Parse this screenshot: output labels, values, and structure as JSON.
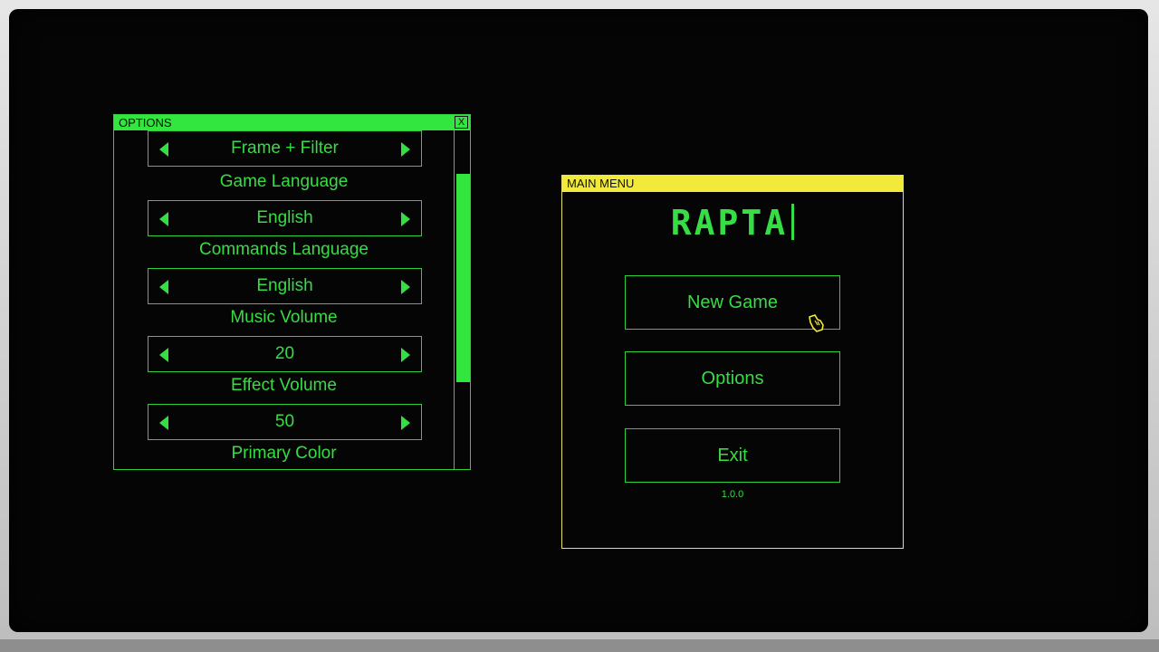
{
  "options_window": {
    "title": "OPTIONS",
    "close_label": "X",
    "settings": [
      {
        "label": "",
        "value": "Frame + Filter"
      },
      {
        "label": "Game Language",
        "value": "English"
      },
      {
        "label": "Commands Language",
        "value": "English"
      },
      {
        "label": "Music Volume",
        "value": "20"
      },
      {
        "label": "Effect Volume",
        "value": "50"
      },
      {
        "label": "Primary Color",
        "value": ""
      }
    ],
    "scroll_position": 0.33
  },
  "main_menu": {
    "title": "MAIN MENU",
    "logo_text": "RAPTA",
    "buttons": [
      "New Game",
      "Options",
      "Exit"
    ],
    "version": "1.0.0"
  },
  "colors": {
    "primary_green": "#36dd44",
    "accent_yellow": "#f1ea3a",
    "background": "#050505"
  }
}
